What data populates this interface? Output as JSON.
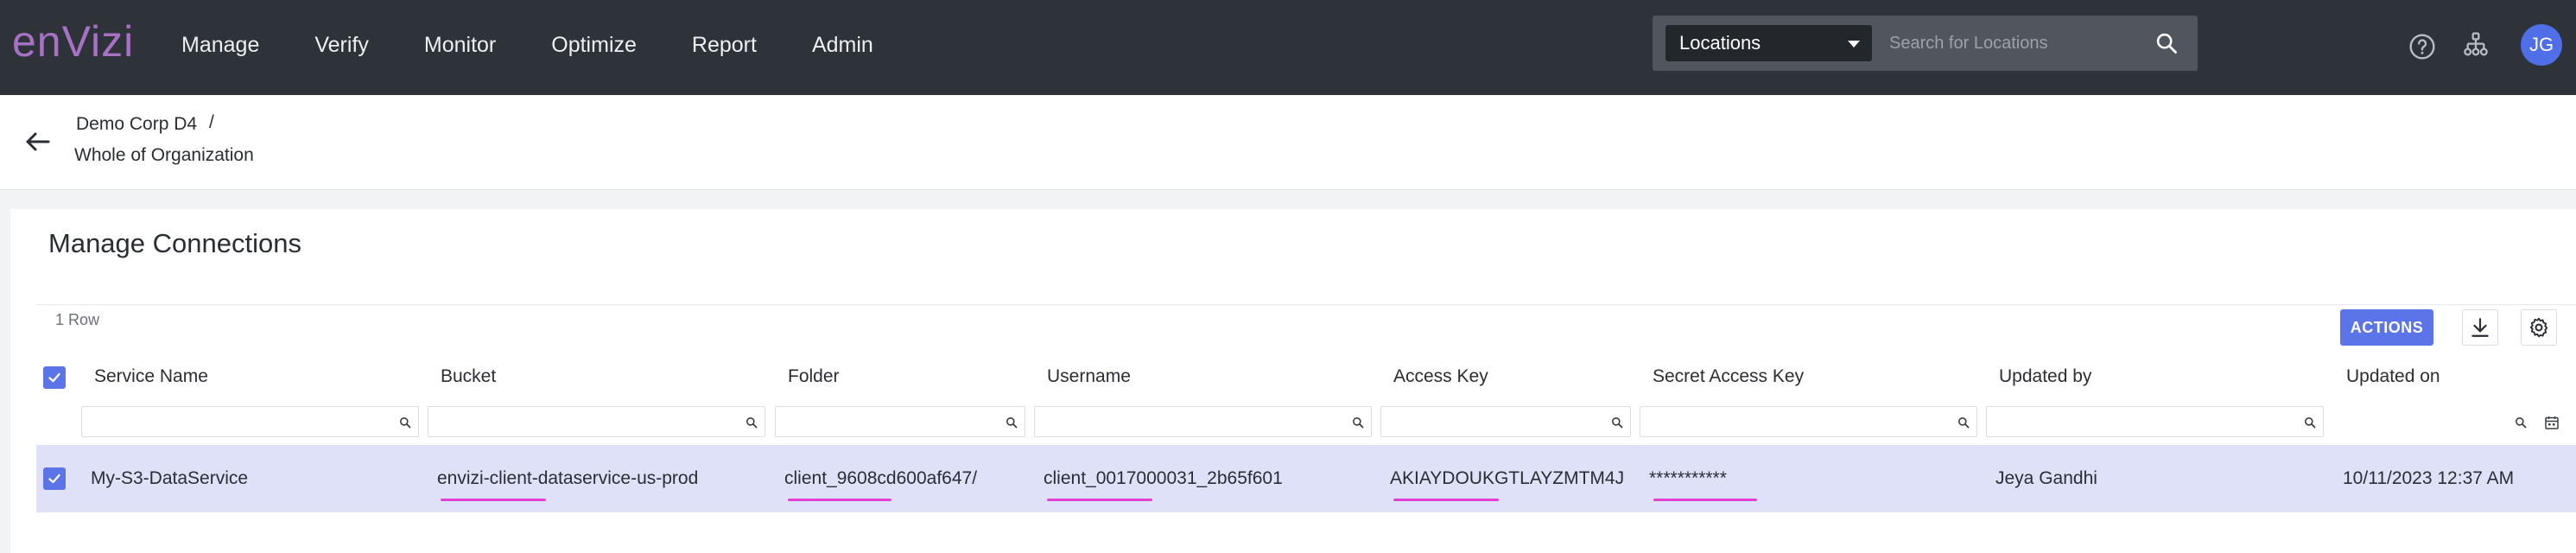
{
  "app": {
    "logo": "enVizi",
    "nav": [
      "Manage",
      "Verify",
      "Monitor",
      "Optimize",
      "Report",
      "Admin"
    ],
    "location_select": "Locations",
    "search_placeholder": "Search for Locations",
    "user_initials": "JG"
  },
  "breadcrumb": {
    "parent": "Demo Corp D4",
    "separator": "/",
    "current": "Whole of Organization"
  },
  "page": {
    "title": "Manage Connections",
    "row_count": "1 Row",
    "actions_label": "ACTIONS"
  },
  "table": {
    "columns": [
      "Service Name",
      "Bucket",
      "Folder",
      "Username",
      "Access Key",
      "Secret Access Key",
      "Updated by",
      "Updated on"
    ],
    "rows": [
      {
        "checked": true,
        "service_name": "My-S3-DataService",
        "bucket": "envizi-client-dataservice-us-prod",
        "folder": "client_9608cd600af647/",
        "username": "client_0017000031_2b65f601",
        "access_key": "AKIAYDOUKGTLAYZMTM4J",
        "secret_access_key": "***********",
        "updated_by": "Jeya Gandhi",
        "updated_on": "10/11/2023 12:37 AM"
      }
    ]
  },
  "colors": {
    "topbar": "#2e3239",
    "accent": "#5b74e8",
    "selected_row": "#dfe1f9",
    "highlight_underline": "#e33fd3",
    "logo": "#a872c4"
  },
  "icons": [
    "search-icon",
    "help-icon",
    "org-hierarchy-icon",
    "back-arrow-icon",
    "download-icon",
    "gear-icon",
    "calendar-icon",
    "checkbox-check-icon"
  ]
}
